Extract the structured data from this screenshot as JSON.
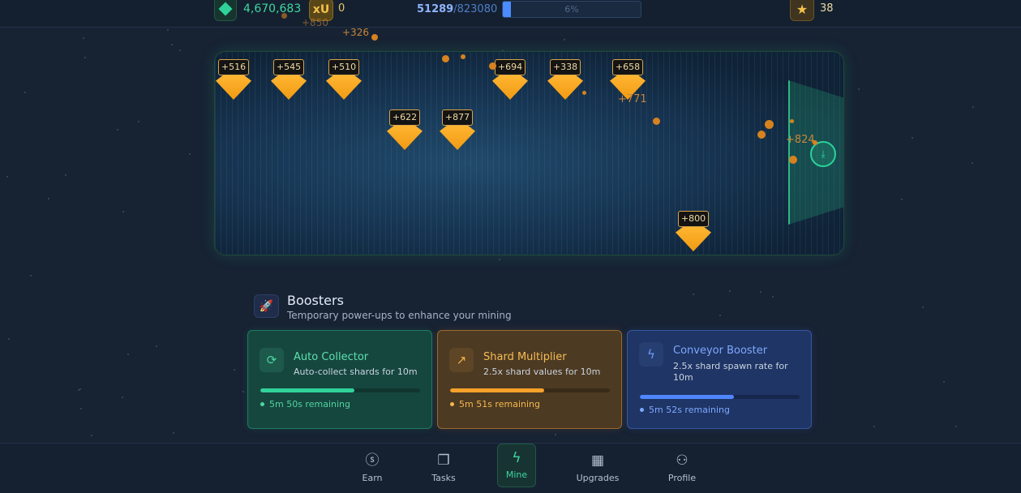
{
  "topbar": {
    "gem_count": "4,670,683",
    "xu_label": "xU",
    "xu_count": "0",
    "progress_current": "51289",
    "progress_total": "/823080",
    "progress_percent_label": "6%",
    "progress_fraction": 0.06,
    "star_count": "38"
  },
  "floaters": [
    "+326",
    "+850",
    "+771",
    "+824"
  ],
  "shards": [
    {
      "label": "+516"
    },
    {
      "label": "+545"
    },
    {
      "label": "+510"
    },
    {
      "label": "+622"
    },
    {
      "label": "+877"
    },
    {
      "label": "+694"
    },
    {
      "label": "+338"
    },
    {
      "label": "+658"
    },
    {
      "label": "+800"
    }
  ],
  "boosters": {
    "title": "Boosters",
    "subtitle": "Temporary power-ups to enhance your mining",
    "cards": [
      {
        "title": "Auto Collector",
        "desc": "Auto-collect shards for 10m",
        "remaining": "5m 50s remaining",
        "progress": 0.59,
        "color": "#32d39a",
        "icon": "refresh-icon"
      },
      {
        "title": "Shard Multiplier",
        "desc": "2.5x shard values for 10m",
        "remaining": "5m 51s remaining",
        "progress": 0.59,
        "color": "#f5a12a",
        "icon": "trending-up-icon"
      },
      {
        "title": "Conveyor Booster",
        "desc": "2.5x shard spawn rate for 10m",
        "remaining": "5m 52s remaining",
        "progress": 0.59,
        "color": "#4f86ff",
        "icon": "lightning-icon"
      }
    ]
  },
  "nav": {
    "items": [
      {
        "label": "Earn",
        "icon": "dollar-icon"
      },
      {
        "label": "Tasks",
        "icon": "tasks-icon"
      },
      {
        "label": "Mine",
        "icon": "lightning-icon",
        "active": true
      },
      {
        "label": "Upgrades",
        "icon": "store-icon"
      },
      {
        "label": "Profile",
        "icon": "user-icon"
      }
    ]
  }
}
